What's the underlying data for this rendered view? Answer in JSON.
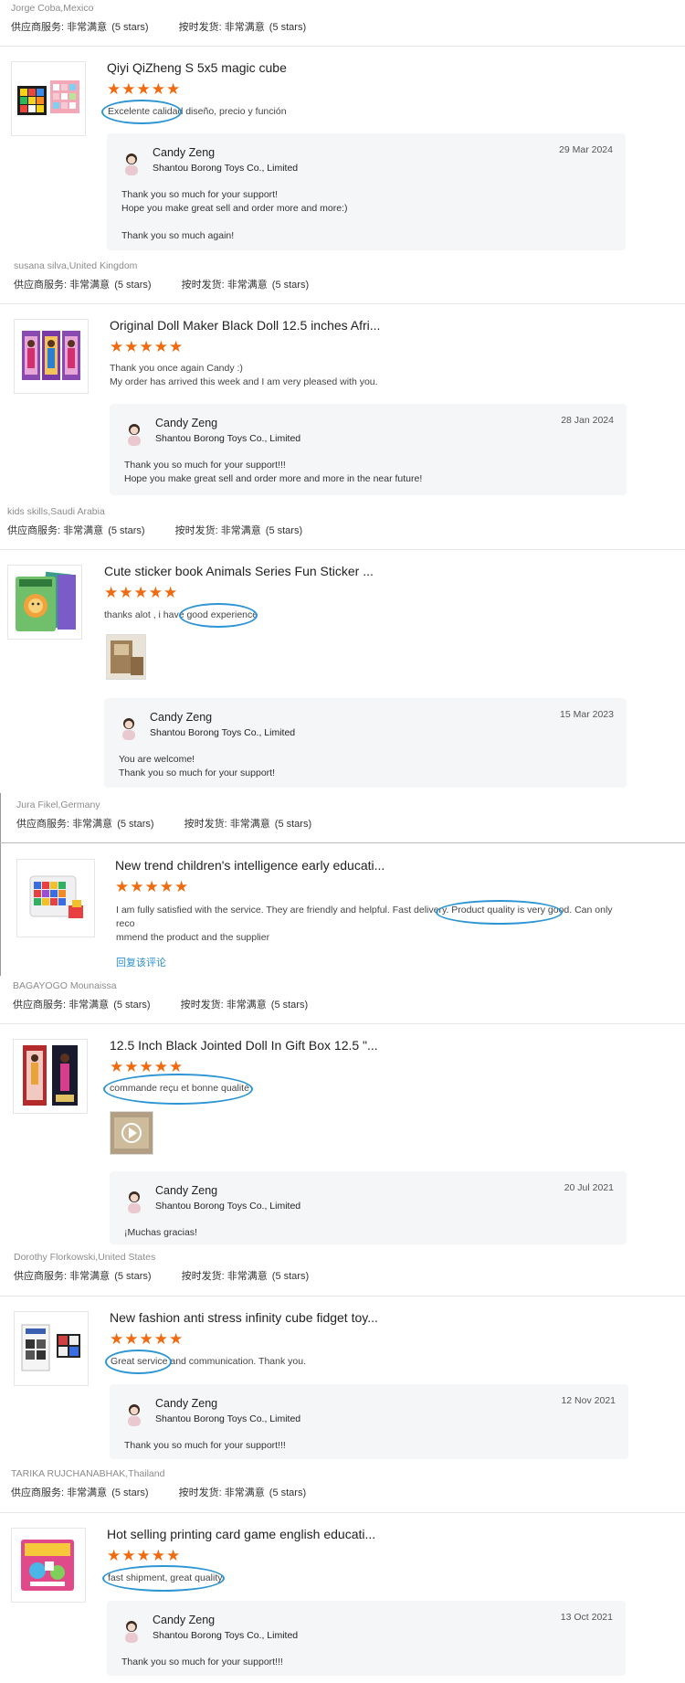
{
  "rating_labels": {
    "service": "供应商服务:",
    "shipping": "按时发货:",
    "value": "非常满意",
    "stars_text": "(5 stars)"
  },
  "star_glyph": "★",
  "accent_color": "#f06a0f",
  "highlight_color": "#2d95d4",
  "reviews": [
    {
      "user": "Jorge Coba,Mexico"
    },
    {
      "product_title": "Qiyi QiZheng S 5x5 magic cube",
      "comment": "Excelente calidad diseño, precio y función",
      "reply": {
        "name": "Candy Zeng",
        "company": "Shantou Borong Toys Co., Limited",
        "date": "29 Mar 2024",
        "lines": [
          "Thank you so much for your support!",
          "Hope you make great sell and order more and more:)",
          "",
          "Thank you so much again!"
        ]
      },
      "user": "susana silva,United Kingdom"
    },
    {
      "product_title": "Original Doll Maker Black Doll 12.5 inches Afri...",
      "comment_lines": [
        "Thank you once again Candy :)",
        "My order has arrived this week and I am very pleased with you."
      ],
      "reply": {
        "name": "Candy Zeng",
        "company": "Shantou Borong Toys Co., Limited",
        "date": "28 Jan 2024",
        "lines": [
          "Thank you so much for your support!!!",
          "Hope you make great sell and order more and more in the near future!"
        ]
      },
      "user": "kids skills,Saudi Arabia"
    },
    {
      "product_title": "Cute sticker book Animals Series Fun Sticker ...",
      "comment": "thanks alot , i have good experience",
      "reply": {
        "name": "Candy Zeng",
        "company": "Shantou Borong Toys Co., Limited",
        "date": "15 Mar 2023",
        "lines": [
          "You are welcome!",
          "Thank you so much for your support!"
        ]
      },
      "user": "Jura Fikel,Germany"
    },
    {
      "product_title": "New trend children's intelligence early educati...",
      "comment_lines": [
        "I am fully satisfied with the service. They are friendly and helpful. Fast delivery. Product quality is very good. Can only reco",
        "mmend the product and the supplier"
      ],
      "reply_link": "回复该评论",
      "user": "BAGAYOGO Mounaissa"
    },
    {
      "product_title": "12.5 Inch Black Jointed Doll In Gift Box 12.5 \"...",
      "comment": "commande reçu et bonne qualité",
      "reply": {
        "name": "Candy Zeng",
        "company": "Shantou Borong Toys Co., Limited",
        "date": "20 Jul 2021",
        "lines": [
          "¡Muchas gracias!"
        ]
      },
      "user": "Dorothy Florkowski,United States"
    },
    {
      "product_title": "New fashion anti stress infinity cube fidget toy...",
      "comment": "Great service and communication. Thank you.",
      "reply": {
        "name": "Candy Zeng",
        "company": "Shantou Borong Toys Co., Limited",
        "date": "12 Nov 2021",
        "lines": [
          "Thank you so much for your support!!!"
        ]
      },
      "user": "TARIKA RUJCHANABHAK,Thailand"
    },
    {
      "product_title": "Hot selling printing card game english educati...",
      "comment": "fast shipment, great quality",
      "reply": {
        "name": "Candy Zeng",
        "company": "Shantou Borong Toys Co., Limited",
        "date": "13 Oct 2021",
        "lines": [
          "Thank you so much for your support!!!"
        ]
      }
    }
  ]
}
